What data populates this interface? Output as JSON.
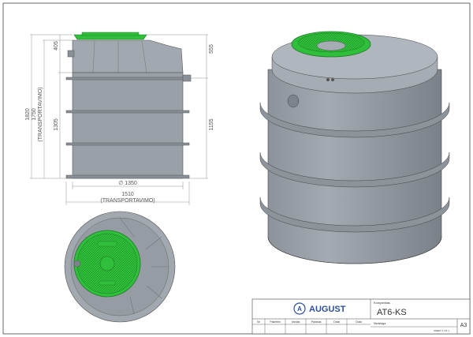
{
  "dimensions": {
    "h_total": "1820",
    "h_transport": "1750",
    "h_transport_note": "(TRANSPORTAVIMO)",
    "h_body": "1305",
    "h_top": "405",
    "h_right_top": "555",
    "h_right_body": "1155",
    "diameter": "∅ 1350",
    "width_transport": "1510",
    "width_transport_note": "(TRANSPORTAVIMO)"
  },
  "colors": {
    "tank_body": "#9aa0a8",
    "tank_shadow": "#7d838c",
    "lid_green": "#2fbf3a",
    "lid_dark": "#1e8e28",
    "brand_blue": "#2b4f9e"
  },
  "title_block": {
    "company": "AUGUST",
    "logo_letter": "A",
    "komplektas_label": "Komplektas",
    "model": "AT6-KS",
    "sheet_size": "A3",
    "header_cells": [
      "Nr",
      "Pakeitim",
      "Vardas",
      "Parasas",
      "Data",
      "Data"
    ],
    "sheet_info": "SHEET 1 OF 1",
    "material_label": "Medziaga"
  }
}
